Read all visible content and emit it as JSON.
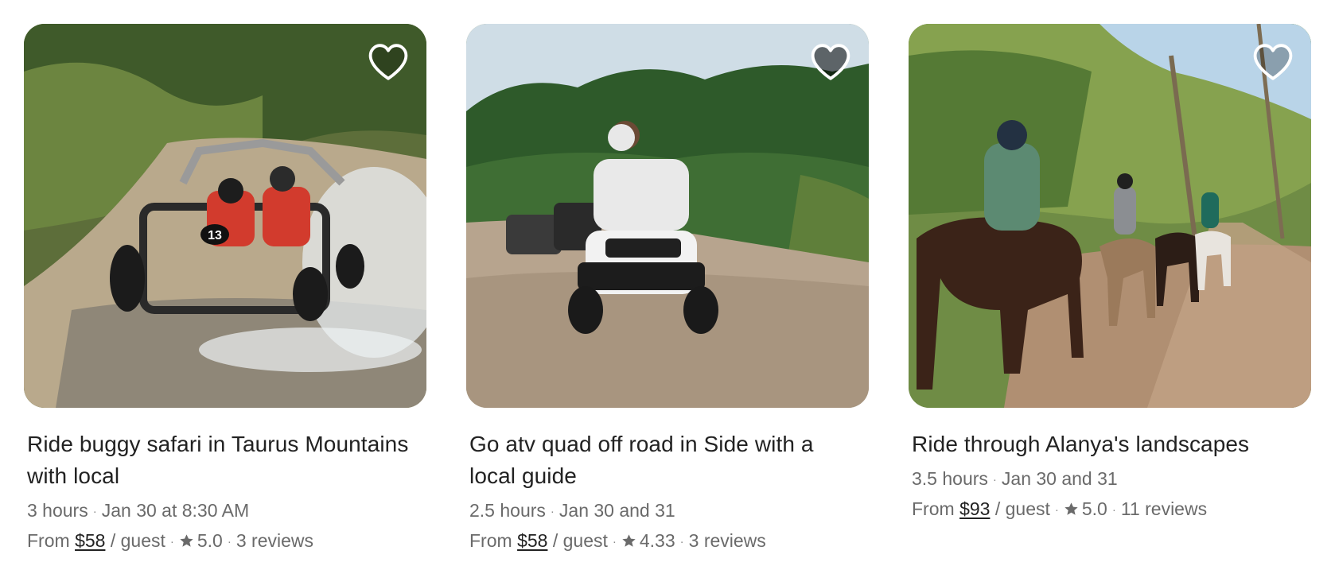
{
  "listings": [
    {
      "title": "Ride buggy safari in Taurus Mountains with local",
      "duration": "3 hours",
      "dates": "Jan 30 at 8:30 AM",
      "from_label": "From",
      "price": "$58",
      "per_label": "/ guest",
      "rating": "5.0",
      "reviews": "3 reviews",
      "heart_fill": "rgba(0,0,0,0.25)",
      "photo_label": "13"
    },
    {
      "title": "Go atv quad off road in Side with a local guide",
      "duration": "2.5 hours",
      "dates": "Jan 30 and 31",
      "from_label": "From",
      "price": "$58",
      "per_label": "/ guest",
      "rating": "4.33",
      "reviews": "3 reviews",
      "heart_fill": "rgba(0,0,0,0.55)"
    },
    {
      "title": "Ride through Alanya's landscapes",
      "duration": "3.5 hours",
      "dates": "Jan 30 and 31",
      "from_label": "From",
      "price": "$93",
      "per_label": "/ guest",
      "rating": "5.0",
      "reviews": "11 reviews",
      "heart_fill": "rgba(0,0,0,0.25)"
    }
  ],
  "icons": {
    "heart": "heart-icon",
    "star": "star-icon"
  },
  "colors": {
    "text": "#222222",
    "muted": "#6a6a6a"
  }
}
